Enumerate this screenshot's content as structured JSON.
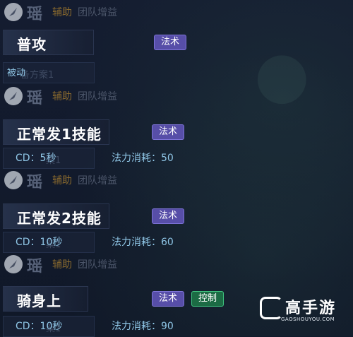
{
  "hero": {
    "name": "瑶",
    "role": "辅助",
    "trait": "团队增益"
  },
  "skills": [
    {
      "name": "普攻",
      "tags": [
        "法术"
      ],
      "passive": "被动",
      "ghost": "备方案1"
    },
    {
      "name": "正常发1技能",
      "tags": [
        "法术"
      ],
      "cd": "CD：5秒",
      "mana": "法力消耗：50",
      "ghost": "案1"
    },
    {
      "name": "正常发2技能",
      "tags": [
        "法术"
      ],
      "cd": "CD：10秒",
      "mana": "法力消耗：60",
      "ghost": "案1"
    },
    {
      "name": "骑身上",
      "tags": [
        "法术",
        "控制"
      ],
      "cd": "CD：10秒",
      "mana": "法力消耗：90",
      "ghost": "案1"
    }
  ],
  "watermark": {
    "brand_cn": "高手游",
    "brand_en": "GAOSHOUYOU.COM"
  },
  "colors": {
    "background": "#121a2c",
    "tag_magic": "#574ea8",
    "tag_control": "#1c6b44",
    "stat_text": "#8fc6e6",
    "role_text": "#8a6a2e"
  },
  "icons": {
    "hero_emblem": "feather-icon",
    "watermark_logo": "g-logo-icon"
  }
}
